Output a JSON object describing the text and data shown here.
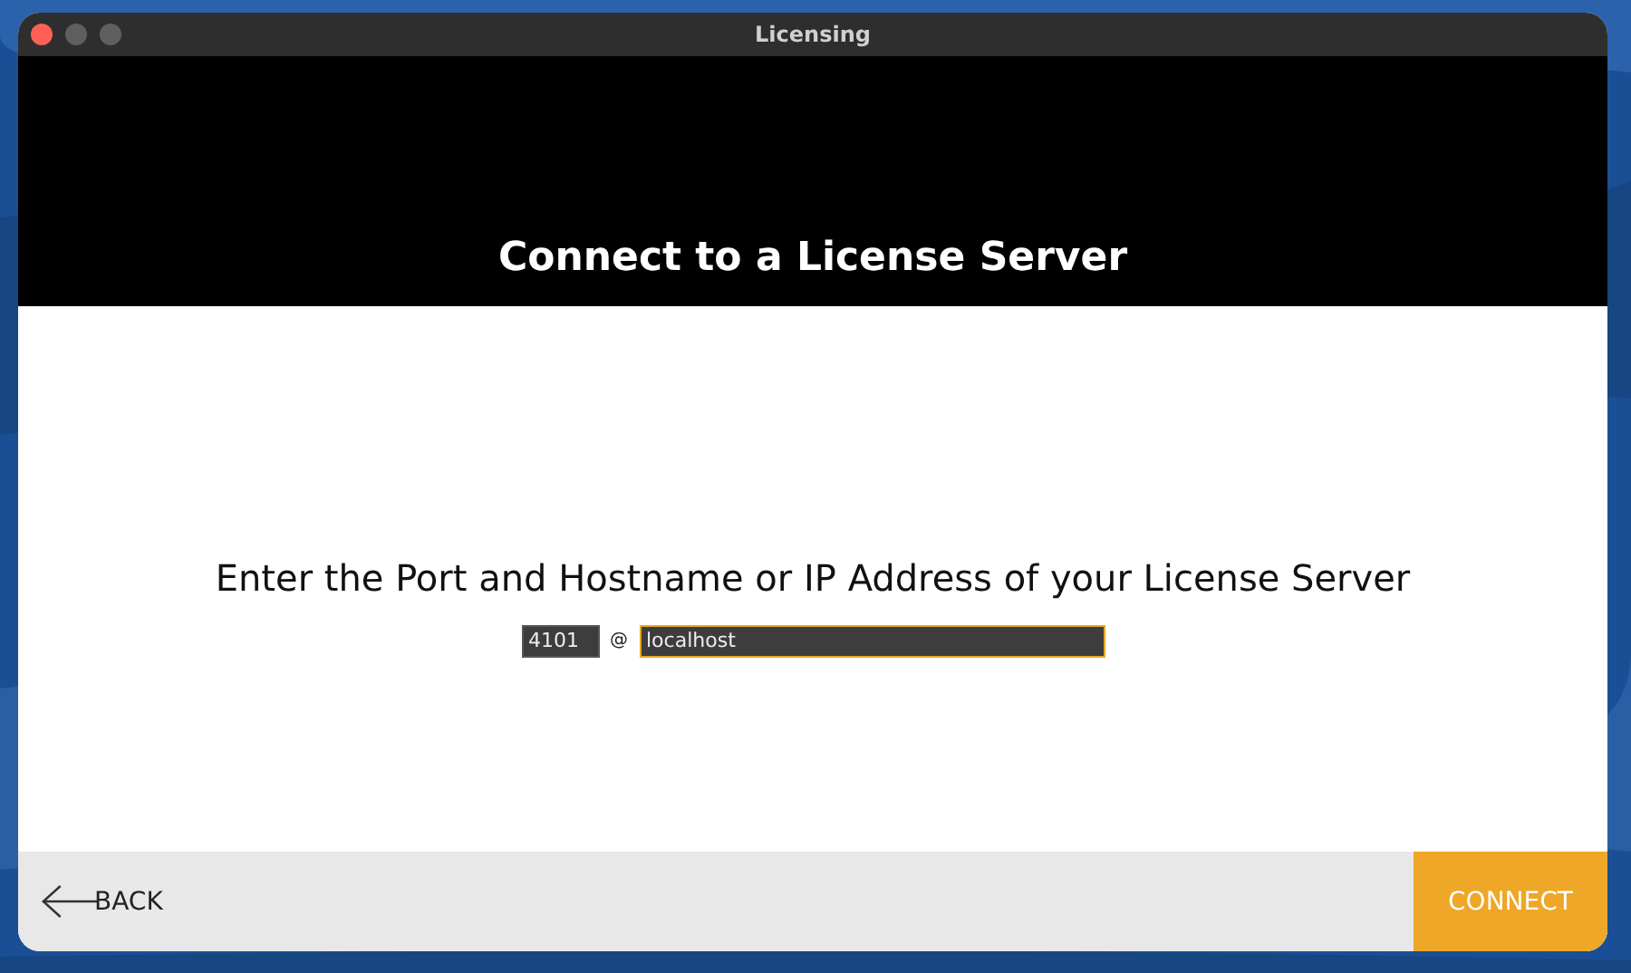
{
  "window": {
    "title": "Licensing"
  },
  "header": {
    "title": "Connect to a License Server"
  },
  "prompt": "Enter the Port and Hostname or IP Address of your License Server",
  "port": {
    "value": "4101"
  },
  "separator": "@",
  "hostname": {
    "value": "localhost",
    "focused": true
  },
  "footer": {
    "back": "BACK",
    "connect": "CONNECT"
  }
}
